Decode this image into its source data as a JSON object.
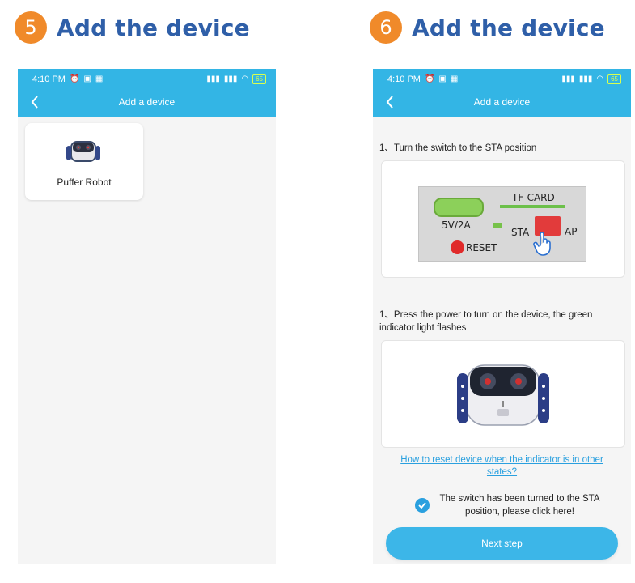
{
  "steps": [
    {
      "number": "5",
      "title": "Add the device",
      "status_time": "4:10 PM",
      "battery": "65",
      "appbar_title": "Add a device",
      "device_name": "Puffer Robot"
    },
    {
      "number": "6",
      "title": "Add the device",
      "status_time": "4:10 PM",
      "battery": "65",
      "appbar_title": "Add a device",
      "instruction_1": "1、Turn the switch to the STA position",
      "panel": {
        "tf_card": "TF-CARD",
        "power": "5V/2A",
        "sta": "STA",
        "ap": "AP",
        "reset": "RESET"
      },
      "instruction_2": "1、Press the power to turn on the device, the green indicator light flashes",
      "reset_link": "How to reset device when the indicator is in other states?",
      "confirm_text": "The switch has been turned to the STA position, please click here!",
      "confirm_checked": true,
      "next_button": "Next step"
    }
  ],
  "colors": {
    "accent": "#33b5e5",
    "step_badge": "#f08a2a",
    "title": "#2f5fa8",
    "link": "#2aa0df"
  }
}
